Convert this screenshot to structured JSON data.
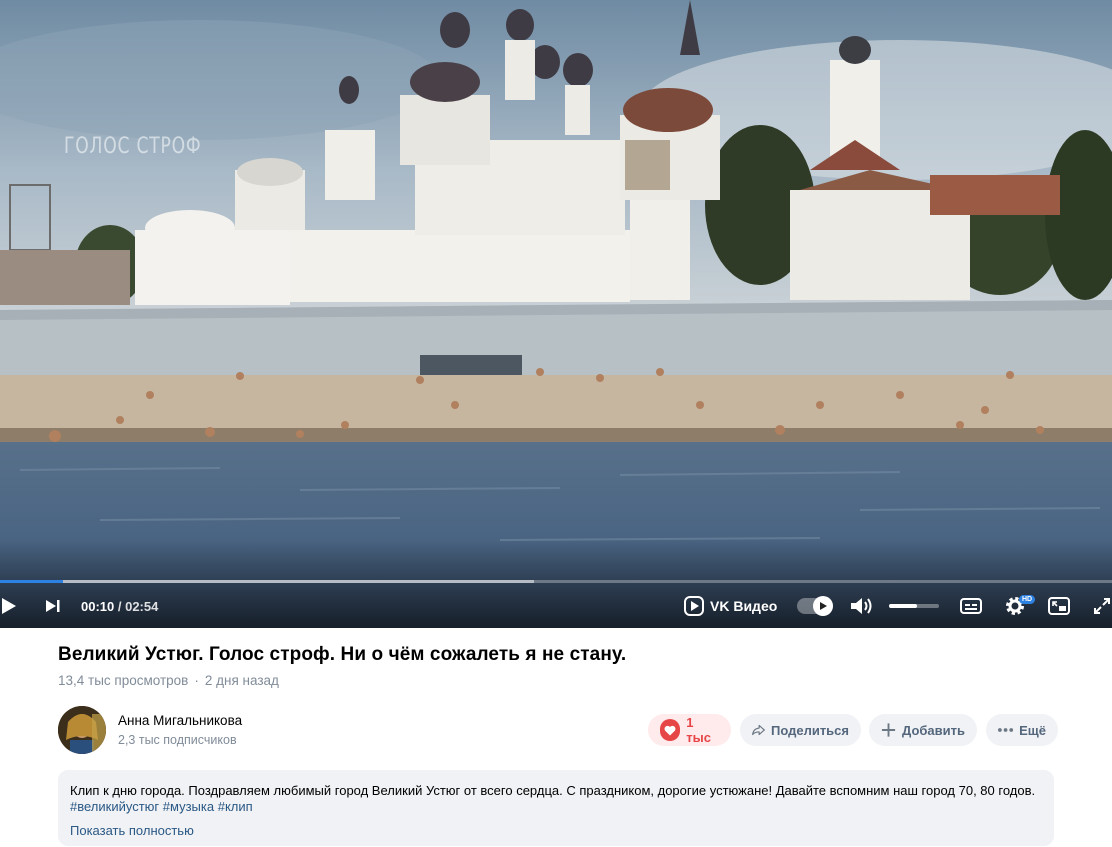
{
  "player": {
    "watermark": "ГОЛОС СТРОФ",
    "time_current": "00:10",
    "time_separator": " / ",
    "time_total": "02:54",
    "progress_fraction": 0.057,
    "buffer_fraction": 0.48,
    "volume_fraction": 0.56,
    "vk_label": "VK Видео",
    "hd_label": "HD",
    "icons": [
      "play-icon",
      "next-icon",
      "vk-video-logo-icon",
      "autoplay-toggle",
      "volume-icon",
      "subtitles-icon",
      "settings-icon",
      "pip-icon",
      "fullscreen-icon"
    ],
    "accent": "#2d81e0"
  },
  "video": {
    "title": "Великий Устюг. Голос строф. Ни о чём сожалеть я не стану.",
    "views": "13,4 тыс просмотров",
    "meta_dot": "·",
    "posted": "2 дня назад"
  },
  "author": {
    "name": "Анна Мигальникова",
    "subscribers": "2,3 тыс подписчиков"
  },
  "actions": {
    "like_count": "1 тыс",
    "share_label": "Поделиться",
    "add_label": "Добавить",
    "more_label": "Ещё",
    "like_color": "#e64646"
  },
  "description": {
    "text": "Клип к дню города. Поздравляем любимый город Великий Устюг от всего сердца.  С праздником, дорогие устюжане! Давайте вспомним наш город 70, 80 годов.",
    "tags": [
      "#великийустюг",
      "#музыка",
      "#клип"
    ],
    "show_more": "Показать полностью"
  }
}
